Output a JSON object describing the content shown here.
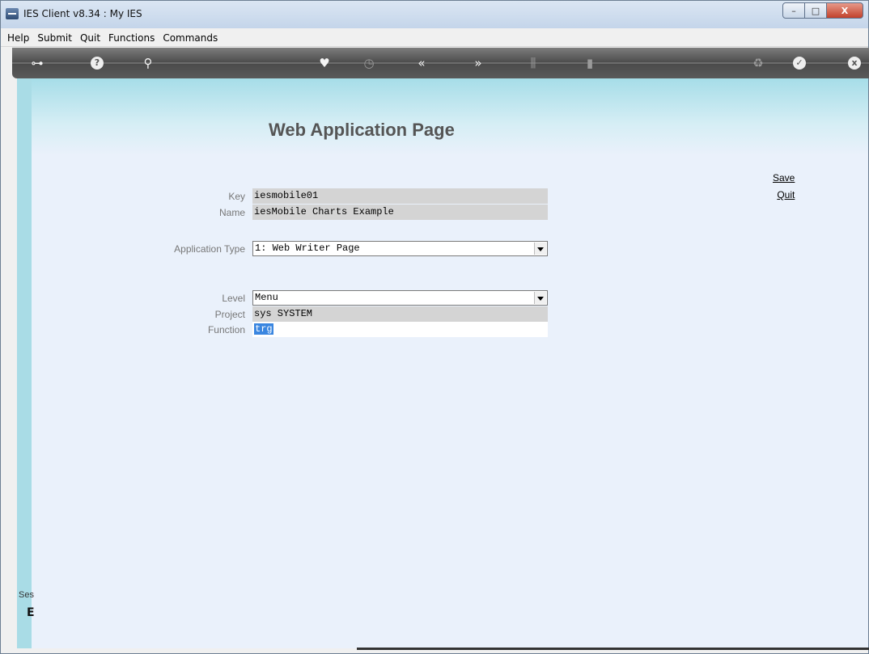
{
  "window": {
    "title": "IES Client v8.34 : My IES",
    "controls": {
      "minimize": "–",
      "maximize": "□",
      "close": "X"
    }
  },
  "menu": [
    "Help",
    "Submit",
    "Quit",
    "Functions",
    "Commands"
  ],
  "toolbar": {
    "icons": [
      {
        "name": "key-icon",
        "glyph": "⊶"
      },
      {
        "name": "help-icon",
        "glyph": "?"
      },
      {
        "name": "search-icon",
        "glyph": "⚲"
      },
      {
        "name": "heart-icon",
        "glyph": "♥"
      },
      {
        "name": "clock-icon",
        "glyph": "◷"
      },
      {
        "name": "previous-icon",
        "glyph": "«"
      },
      {
        "name": "next-icon",
        "glyph": "»"
      },
      {
        "name": "tree-icon",
        "glyph": "⫼"
      },
      {
        "name": "page-icon",
        "glyph": "▮"
      },
      {
        "name": "refresh-icon",
        "glyph": "♻"
      },
      {
        "name": "check-icon",
        "glyph": "✓"
      },
      {
        "name": "close-icon",
        "glyph": "x"
      }
    ]
  },
  "page": {
    "title": "Web Application Page",
    "actions": {
      "save": "Save",
      "quit": "Quit"
    }
  },
  "form": {
    "key": {
      "label": "Key",
      "value": "iesmobile01"
    },
    "name": {
      "label": "Name",
      "value": "iesMobile Charts Example"
    },
    "application_type": {
      "label": "Application Type",
      "value": "1: Web Writer Page"
    },
    "level": {
      "label": "Level",
      "value": "Menu"
    },
    "project": {
      "label": "Project",
      "value": "sys SYSTEM"
    },
    "function": {
      "label": "Function",
      "value": "trg"
    }
  },
  "session": {
    "label": "Ses",
    "glyph": "E"
  },
  "colors": {
    "toolbar": "#4a4a4a",
    "banner": "#a6dde8",
    "content": "#eaf1fb",
    "readonly_field": "#d4d4d4",
    "selection": "#3a86e0"
  }
}
